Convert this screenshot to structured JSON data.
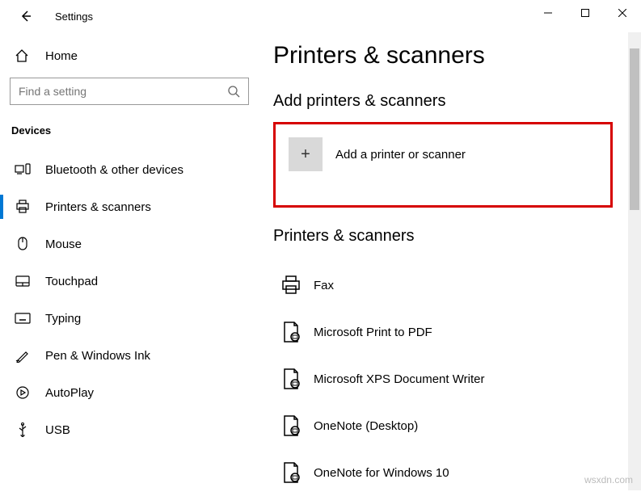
{
  "window": {
    "title": "Settings"
  },
  "sidebar": {
    "home_label": "Home",
    "search_placeholder": "Find a setting",
    "section_label": "Devices",
    "items": [
      {
        "label": "Bluetooth & other devices"
      },
      {
        "label": "Printers & scanners"
      },
      {
        "label": "Mouse"
      },
      {
        "label": "Touchpad"
      },
      {
        "label": "Typing"
      },
      {
        "label": "Pen & Windows Ink"
      },
      {
        "label": "AutoPlay"
      },
      {
        "label": "USB"
      }
    ]
  },
  "main": {
    "page_title": "Printers & scanners",
    "add_heading": "Add printers & scanners",
    "add_label": "Add a printer or scanner",
    "list_heading": "Printers & scanners",
    "printers": [
      {
        "label": "Fax"
      },
      {
        "label": "Microsoft Print to PDF"
      },
      {
        "label": "Microsoft XPS Document Writer"
      },
      {
        "label": "OneNote (Desktop)"
      },
      {
        "label": "OneNote for Windows 10"
      }
    ]
  },
  "watermark": "wsxdn.com"
}
